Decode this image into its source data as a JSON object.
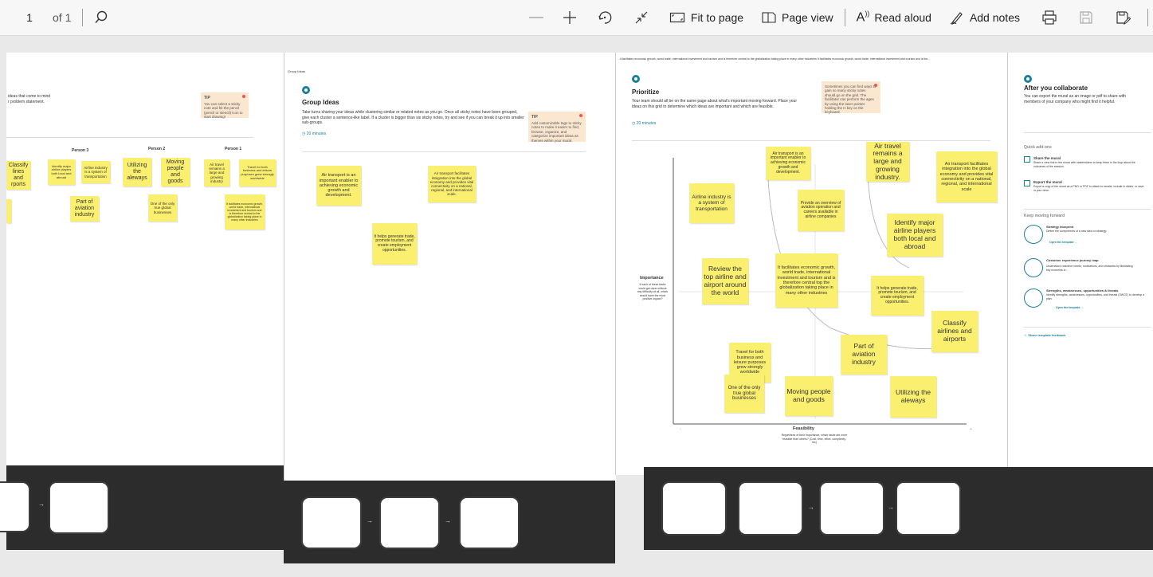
{
  "toolbar": {
    "page_number": "1",
    "page_of": "of 1",
    "fit_to_page": "Fit to page",
    "page_view": "Page view",
    "read_aloud": "Read aloud",
    "add_notes": "Add notes"
  },
  "sheet1": {
    "intro": "ideas that come to mind\nr problem statement.",
    "tip_label": "TIP",
    "tip_text": "You can select a sticky note and hit the pencil (pencil or stencil) icon to start drawing!",
    "persons": [
      "Person 3",
      "Person 2",
      "Person 1"
    ],
    "stickies": [
      "Classify\nlines and\nrports",
      "Identify major airline players both local and abroad",
      "Airline industry is a system of transportation",
      "Utilizing the aleways",
      "Moving people and goods",
      "Air travel remains a large and growing industry",
      "Travel for both business and leisure purposes grew strongly worldwide",
      "Part of aviation industry",
      "One of the only true global businesses",
      "It facilitates economic growth, world trade, international investment and tourism and is therefore central to the globalization taking place in many other industries"
    ]
  },
  "sheet2": {
    "header": "Group Ideas",
    "title": "Group Ideas",
    "desc": "Take turns sharing your ideas while clustering similar or related notes as you go. Once all sticky notes have been grouped, give each cluster a sentence-like label. If a cluster is bigger than six sticky notes, try and see if you can break it up into smaller sub-groups.",
    "time": "20 minutes",
    "tip_label": "TIP",
    "tip_text": "Add customizable tags to sticky notes to make it easier to find, browse, organize, and categorize important ideas as themes within your mural.",
    "stickies": [
      "Air transport is an important enabler to achieving economic growth and development.",
      "Air transport facilitates integration into the global economy and provides vital connectivity on a national, regional, and international scale.",
      "It helps generate trade, promote tourism, and create employment opportunities."
    ]
  },
  "sheet3": {
    "banner": "...it facilitates economic growth, world trade, international investment and tourism and is therefore central to the globalization taking place in many other industries It facilitates economic growth, world trade, international investment and tourism and is the...",
    "title": "Prioritize",
    "desc": "Your team should all be on the same page about what's important moving forward. Place your ideas on this grid to determine which ideas are important and which are feasible.",
    "time": "20 minutes",
    "tip_text": "Sometimes you can find ways to gain so many sticky notes should go on the grid. The facilitator can perform the ages by using the laser pointer holding the H key on the keyboard.",
    "importance_label": "Importance",
    "importance_desc": "If each of these tasks could get done without any difficulty at all, which would have the most positive impact?",
    "feasibility_label": "Feasibility",
    "feasibility_desc": "Regardless of their importance, which tasks are more feasible than others? (Cost, time, effort, complexity, etc)",
    "stickies": [
      "Air transport is an important enabler to achieving economic growth and development.",
      "Air travel remains a large and growing industry.",
      "Air transport facilitates integration into the global economy and provides vital connectivity on a national, regional, and international scale",
      "Airline industry is a system of transportation",
      "Provide an overview of aviation operation and careers available in airline companies",
      "Identify major airline players both local and abroad",
      "Review the top airline and airport around the world",
      "It facilitates economic growth, world trade, international investment and tourism and is therefore central top the globalization taking place in many other industries",
      "It helps generate trade, promote tourism, and create employment opportunities.",
      "Classify airlines and airports",
      "Travel for both business and leisure purposes grew strongly worldwide",
      "Part of aviation industry",
      "One of the only true global businesses",
      "Moving people and goods",
      "Utilizing the aleways"
    ]
  },
  "sheet4": {
    "title": "After you collaborate",
    "desc": "You can export the mural as an image or pdf to share with members of your company who might find it helpful.",
    "quick_addons": "Quick add-ons",
    "share_title": "Share the mural",
    "share_desc": "Share a view link to the mural with stakeholders to keep them in the loop about the outcomes of the session.",
    "export_title": "Export the mural",
    "export_desc": "Export a copy of the mural as a PNG or PDF to attach to emails, include in slides, or save in your drive.",
    "keep_moving": "Keep moving forward",
    "templates": [
      {
        "title": "Strategy blueprint",
        "desc": "Define the components of a new idea or strategy.",
        "link": "Open the template →"
      },
      {
        "title": "Customer experience journey map",
        "desc": "Understand customer needs, motivations, and obstacles by illustrating key moments in...",
        "link": ""
      },
      {
        "title": "Strengths, weaknesses, opportunities & threats",
        "desc": "Identify strengths, weaknesses, opportunities, and threats (SWOT) to develop a plan.",
        "link": "Open the template →"
      }
    ],
    "feedback": "Share template feedback"
  },
  "colors": {
    "sticky": "#fbef6f",
    "accent": "#1b7f9a",
    "dark_band": "#2c2c2c",
    "toolbar_bg": "#f7f7f7"
  },
  "icons": [
    "search-icon",
    "zoom-out-icon",
    "zoom-in-icon",
    "rotate-icon",
    "fit-collapse-icon",
    "fit-to-page-icon",
    "page-view-icon",
    "read-aloud-icon",
    "add-notes-icon",
    "print-icon",
    "save-icon",
    "save-as-icon"
  ]
}
